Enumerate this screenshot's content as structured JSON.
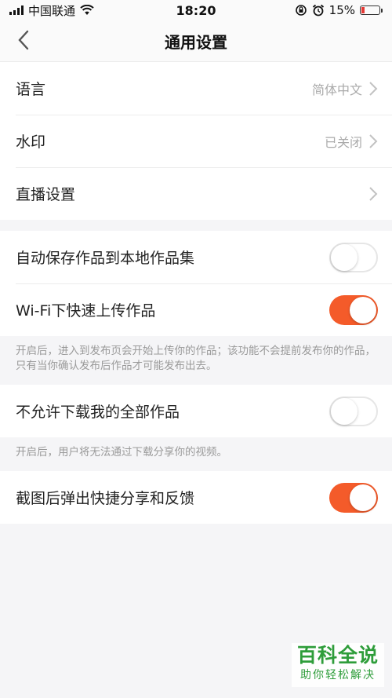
{
  "status_bar": {
    "carrier": "中国联通",
    "time": "18:20",
    "battery_percent": "15%"
  },
  "header": {
    "title": "通用设置"
  },
  "general": {
    "items": [
      {
        "label": "语言",
        "value": "简体中文"
      },
      {
        "label": "水印",
        "value": "已关闭"
      },
      {
        "label": "直播设置",
        "value": ""
      }
    ]
  },
  "upload": {
    "auto_save_label": "自动保存作品到本地作品集",
    "auto_save_on": false,
    "wifi_upload_label": "Wi-Fi下快速上传作品",
    "wifi_upload_on": true,
    "note": "开启后，进入到发布页会开始上传你的作品；该功能不会提前发布你的作品，只有当你确认发布后作品才可能发布出去。"
  },
  "download": {
    "label": "不允许下载我的全部作品",
    "on": false,
    "note": "开启后，用户将无法通过下载分享你的视频。"
  },
  "screenshot": {
    "label": "截图后弹出快捷分享和反馈",
    "on": true
  },
  "watermark_overlay": {
    "title": "百科全说",
    "subtitle": "助你轻松解决"
  },
  "colors": {
    "accent": "#f45b2a",
    "background": "#f5f5f7"
  }
}
